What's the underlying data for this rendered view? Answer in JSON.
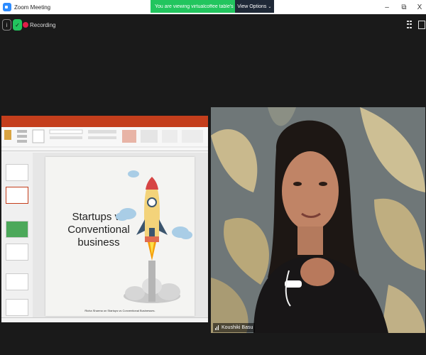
{
  "window": {
    "title": "Zoom Meeting",
    "share_banner": "You are viewing virtualcoffee table's screen",
    "view_options": "View Options",
    "minimize": "–",
    "maximize": "⧉",
    "close": "X"
  },
  "toolbar": {
    "recording_label": "Recording"
  },
  "presentation": {
    "slide_title": "Startups vs Conventional business",
    "slide_title_line1": "Startups vs",
    "slide_title_line2": "Conventional",
    "slide_title_line3": "business",
    "slide_caption": "Richa Sharma on Startups vs Conventional Businesses."
  },
  "participant": {
    "name": "Koushiki Basu"
  },
  "colors": {
    "share_banner": "#22c55e",
    "ppt_accent": "#c43e1c",
    "background": "#1a1a1a"
  }
}
